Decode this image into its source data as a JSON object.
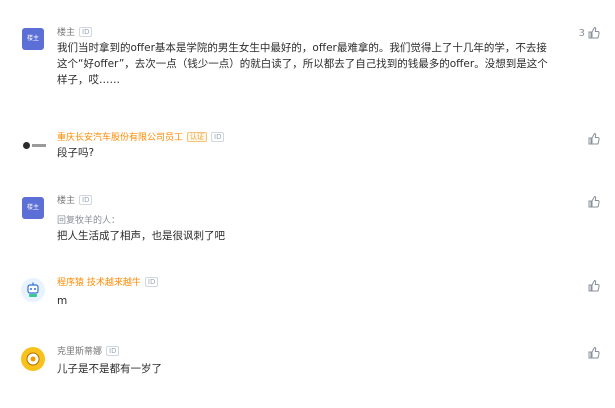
{
  "comments": [
    {
      "avatar_text": "楼主",
      "author": "楼主",
      "badge": "ID",
      "content": "我们当时拿到的offer基本是学院的男生女生中最好的，offer最难拿的。我们觉得上了十几年的学，不去接这个“好offer”，去次一点（钱少一点）的就白读了，所以都去了自己找到的钱最多的offer。没想到是这个样子，哎……",
      "like_count": "3",
      "like_icon": "thumbs-up-icon"
    },
    {
      "avatar_text": "",
      "author": "重庆长安汽车股份有限公司员工",
      "verified_badge": "认证",
      "badge": "ID",
      "content": "段子吗?",
      "like_count": "",
      "like_icon": "thumbs-up-icon"
    },
    {
      "avatar_text": "楼主",
      "author": "楼主",
      "badge": "ID",
      "reply_to": "回复牧羊的人：",
      "content": "把人生活成了相声，也是很讽刺了吧",
      "like_count": "",
      "like_icon": "thumbs-up-icon"
    },
    {
      "avatar_text": "",
      "author": "程序猿 技术越来越牛",
      "badge": "ID",
      "content": "m",
      "like_count": "",
      "like_icon": "thumbs-up-icon"
    },
    {
      "avatar_text": "",
      "author": "克里斯蒂娜",
      "badge": "ID",
      "content": "儿子是不是都有一岁了",
      "like_count": "",
      "like_icon": "thumbs-up-icon"
    }
  ],
  "colors": {
    "op_avatar": "#5b6fd6",
    "company_author": "#ff8a00",
    "meta_gray": "#777777"
  }
}
